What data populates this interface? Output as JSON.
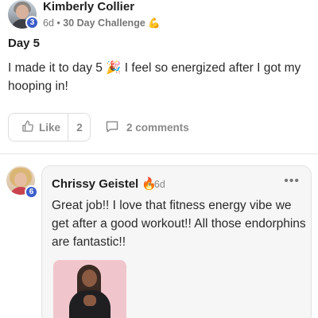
{
  "post": {
    "author": "Kimberly Collier",
    "author_level": "3",
    "time": "6d",
    "separator": "•",
    "category": "30 Day Challenge",
    "category_emoji": "💪",
    "title": "Day 5",
    "body": "I made it to day 5 🎉 I feel so energized after I got my hooping in!"
  },
  "actions": {
    "like_label": "Like",
    "like_count": "2",
    "comments_label": "2 comments"
  },
  "comment": {
    "author": "Chrissy Geistel",
    "author_emoji": "🔥",
    "author_level": "6",
    "time": "6d",
    "separator": "•",
    "more_label": "•••",
    "body": "Great job!! I love that fitness energy vibe we get after a good workout!! All those endorphins are fantastic!!"
  },
  "icons": {
    "like": "thumbs-up-icon",
    "comment": "speech-bubble-icon",
    "more": "more-horizontal-icon"
  },
  "colors": {
    "level_badge": "#3b5dc9",
    "muted_text": "#8a8a8a",
    "comment_bg": "#f6f6f6"
  }
}
